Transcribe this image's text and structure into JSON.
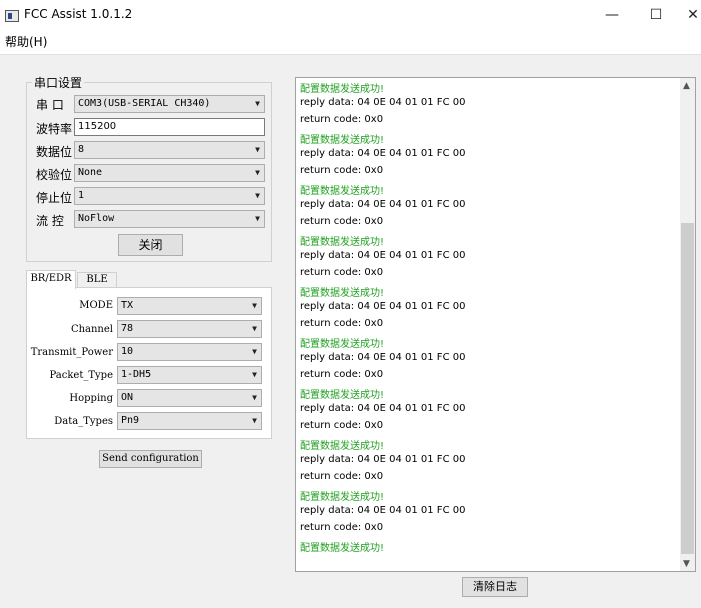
{
  "window": {
    "title": "FCC Assist 1.0.1.2",
    "minimize": "—",
    "maximize": "☐",
    "close": "✕"
  },
  "menu": {
    "help": "帮助(H)"
  },
  "serial": {
    "group_title": "串口设置",
    "port_label": "串  口",
    "port_value": "COM3(USB-SERIAL CH340)",
    "baud_label": "波特率",
    "baud_value": "115200",
    "databits_label": "数据位",
    "databits_value": "8",
    "parity_label": "校验位",
    "parity_value": "None",
    "stopbits_label": "停止位",
    "stopbits_value": "1",
    "flow_label": "流  控",
    "flow_value": "NoFlow",
    "close_button": "关闭"
  },
  "tabs": {
    "bredr": "BR/EDR",
    "ble": "BLE"
  },
  "params": {
    "mode_label": "MODE",
    "mode_value": "TX",
    "channel_label": "Channel",
    "channel_value": "78",
    "power_label": "Transmit_Power",
    "power_value": "10",
    "packet_label": "Packet_Type",
    "packet_value": "1-DH5",
    "hopping_label": "Hopping",
    "hopping_value": "ON",
    "datatypes_label": "Data_Types",
    "datatypes_value": "Pn9"
  },
  "send_button": "Send configuration",
  "clear_button": "清除日志",
  "log": {
    "success_text": "配置数据发送成功!",
    "reply_text": "reply data: 04 0E 04 01 01 FC 00",
    "return_text": "return code: 0x0"
  },
  "icons": {
    "scroll_up": "chevron-up-icon",
    "scroll_down": "chevron-down-icon",
    "dropdown": "chevron-down-icon"
  },
  "colors": {
    "success": "#22a022"
  }
}
